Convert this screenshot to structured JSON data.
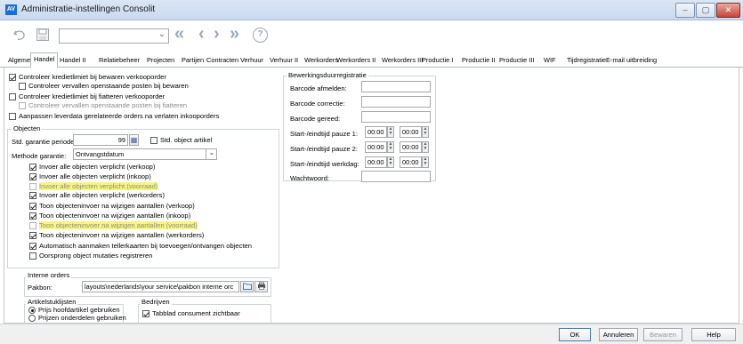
{
  "window": {
    "title": "Administratie-instellingen Consolit",
    "app_icon": "AV"
  },
  "window_controls": {
    "minimize": "–",
    "maximize": "▢",
    "close": "✕"
  },
  "toolbar": {
    "undo_icon": "undo-icon",
    "save_icon": "save-icon",
    "nav_first": "«",
    "nav_prev": "‹",
    "nav_next": "›",
    "nav_last": "»",
    "help": "?",
    "combo_value": "",
    "combo_arrow": "⌄"
  },
  "tabs": [
    "Algemeen",
    "Handel",
    "Handel II",
    "Relatiebeheer",
    "Projecten",
    "Partijen",
    "Contracten",
    "Verhuur",
    "Verhuur II",
    "Werkorders",
    "Werkorders II",
    "Werkorders III",
    "Productie I",
    "Productie II",
    "Productie III",
    "WIF",
    "Tijdregistratie",
    "E-mail uitbreiding"
  ],
  "active_tab": "Handel",
  "credit": {
    "c1": "Controleer kredietlimiet bij bewaren verkooporder",
    "c2": "Controleer vervallen openstaande posten bij bewaren",
    "c3": "Controleer kredietlimiet bij fiatteren verkooporder",
    "c4": "Controleer vervallen openstaande posten bij fiatteren",
    "c5": "Aanpassen leverdata gerelateerde orders na verlaten inkooporders"
  },
  "objecten": {
    "legend": "Objecten",
    "garantie_label": "Std. garantie periode:",
    "garantie_value": "99",
    "std_object_label": "Std. object artikel",
    "methode_label": "Methode garantie:",
    "methode_value": "Ontvangstdatum",
    "items": [
      "Invoer alle objecten verplicht (verkoop)",
      "Invoer alle objecten verplicht (inkoop)",
      "Invoer alle objecten verplicht (voorraad)",
      "Invoer alle objecten verplicht (werkorders)",
      "Toon objecteninvoer na wijzigen aantallen (verkoop)",
      "Toon objecteninvoer na wijzigen aantallen (inkoop)",
      "Toon objecteninvoer na wijzigen aantallen (voorraad)",
      "Toon objecteninvoer na wijzigen aantallen (werkorders)",
      "Automatisch aanmaken tellerkaarten bij toevoegen/ontvangen objecten",
      "Oorsprong object mutaties registreren"
    ]
  },
  "interne_orders": {
    "legend": "Interne orders",
    "pakbon_label": "Pakbon:",
    "pakbon_value": "layouts\\nederlands\\your service\\pakbon interne orc"
  },
  "artikelstuklijsten": {
    "legend": "Artikelstuklijsten",
    "opt1": "Prijs hoofdartikel gebruiken",
    "opt2": "Prijzen onderdelen gebruiken"
  },
  "bedrijven": {
    "legend": "Bedrijven",
    "tabblad": "Tabblad consument zichtbaar"
  },
  "bewerking": {
    "legend": "Bewerkingsduurregistratie",
    "barcode_afmelden": "Barcode afmelden:",
    "barcode_correctie": "Barcode correctie:",
    "barcode_gereed": "Barcode gereed:",
    "pauze1": "Start-/eindtijd pauze 1:",
    "pauze2": "Start-/eindtijd pauze 2:",
    "werkdag": "Start-/eindtijd werkdag:",
    "wachtwoord": "Wachtwoord:",
    "time": "00:00"
  },
  "buttons": {
    "ok": "OK",
    "annuleren": "Annuleren",
    "bewaren": "Bewaren",
    "help": "Help"
  }
}
